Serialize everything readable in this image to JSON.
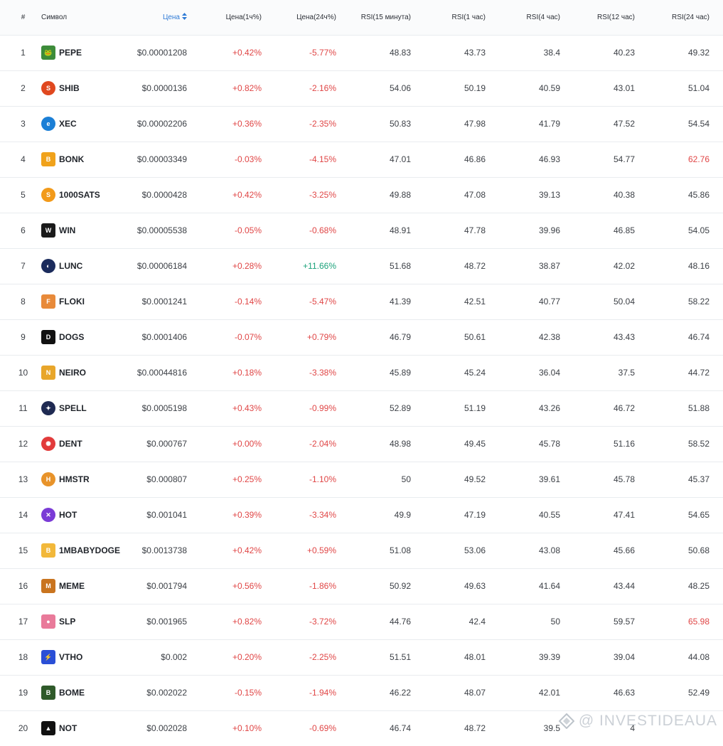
{
  "header": {
    "num": "#",
    "symbol": "Символ",
    "price": "Цена",
    "chg1h": "Цена(1ч%)",
    "chg24h": "Цена(24ч%)",
    "rsi15m": "RSI(15 минута)",
    "rsi1h": "RSI(1 час)",
    "rsi4h": "RSI(4 час)",
    "rsi12h": "RSI(12 час)",
    "rsi24h": "RSI(24 час)"
  },
  "colors": {
    "up": "#e04646",
    "down": "#1ba27a",
    "accent": "#2f7bd6",
    "neutral": "#3b3f45"
  },
  "rows": [
    {
      "n": "1",
      "sym": "PEPE",
      "icon": "pepe-frog-icon",
      "ic": "#3d8c3a",
      "price": "$0.00001208",
      "c1": "+0.42%",
      "c1c": "red",
      "c24": "-5.77%",
      "c24c": "red",
      "r15": "48.83",
      "r1": "43.73",
      "r4": "38.4",
      "r12": "40.23",
      "r24": "49.32",
      "r24c": "dark"
    },
    {
      "n": "2",
      "sym": "SHIB",
      "icon": "shiba-icon",
      "ic": "#e0481f",
      "price": "$0.0000136",
      "c1": "+0.82%",
      "c1c": "red",
      "c24": "-2.16%",
      "c24c": "red",
      "r15": "54.06",
      "r1": "50.19",
      "r4": "40.59",
      "r12": "43.01",
      "r24": "51.04",
      "r24c": "dark"
    },
    {
      "n": "3",
      "sym": "XEC",
      "icon": "ecash-icon",
      "ic": "#1b7fd6",
      "price": "$0.00002206",
      "c1": "+0.36%",
      "c1c": "red",
      "c24": "-2.35%",
      "c24c": "red",
      "r15": "50.83",
      "r1": "47.98",
      "r4": "41.79",
      "r12": "47.52",
      "r24": "54.54",
      "r24c": "dark"
    },
    {
      "n": "4",
      "sym": "BONK",
      "icon": "bonk-dog-icon",
      "ic": "#f0a21b",
      "price": "$0.00003349",
      "c1": "-0.03%",
      "c1c": "red",
      "c24": "-4.15%",
      "c24c": "red",
      "r15": "47.01",
      "r1": "46.86",
      "r4": "46.93",
      "r12": "54.77",
      "r24": "62.76",
      "r24c": "red"
    },
    {
      "n": "5",
      "sym": "1000SATS",
      "icon": "sats-coin-icon",
      "ic": "#f29a1a",
      "price": "$0.0000428",
      "c1": "+0.42%",
      "c1c": "red",
      "c24": "-3.25%",
      "c24c": "red",
      "r15": "49.88",
      "r1": "47.08",
      "r4": "39.13",
      "r12": "40.38",
      "r24": "45.86",
      "r24c": "dark"
    },
    {
      "n": "6",
      "sym": "WIN",
      "icon": "wink-icon",
      "ic": "#1a1a1a",
      "price": "$0.00005538",
      "c1": "-0.05%",
      "c1c": "red",
      "c24": "-0.68%",
      "c24c": "red",
      "r15": "48.91",
      "r1": "47.78",
      "r4": "39.96",
      "r12": "46.85",
      "r24": "54.05",
      "r24c": "dark"
    },
    {
      "n": "7",
      "sym": "LUNC",
      "icon": "luna-classic-icon",
      "ic": "#1b2b5c",
      "price": "$0.00006184",
      "c1": "+0.28%",
      "c1c": "red",
      "c24": "+11.66%",
      "c24c": "green",
      "r15": "51.68",
      "r1": "48.72",
      "r4": "38.87",
      "r12": "42.02",
      "r24": "48.16",
      "r24c": "dark"
    },
    {
      "n": "8",
      "sym": "FLOKI",
      "icon": "floki-viking-icon",
      "ic": "#e88a3a",
      "price": "$0.0001241",
      "c1": "-0.14%",
      "c1c": "red",
      "c24": "-5.47%",
      "c24c": "red",
      "r15": "41.39",
      "r1": "42.51",
      "r4": "40.77",
      "r12": "50.04",
      "r24": "58.22",
      "r24c": "dark"
    },
    {
      "n": "9",
      "sym": "DOGS",
      "icon": "dogs-icon",
      "ic": "#111111",
      "price": "$0.0001406",
      "c1": "-0.07%",
      "c1c": "red",
      "c24": "+0.79%",
      "c24c": "red",
      "r15": "46.79",
      "r1": "50.61",
      "r4": "42.38",
      "r12": "43.43",
      "r24": "46.74",
      "r24c": "dark"
    },
    {
      "n": "10",
      "sym": "NEIRO",
      "icon": "neiro-dog-icon",
      "ic": "#e8a62a",
      "price": "$0.00044816",
      "c1": "+0.18%",
      "c1c": "red",
      "c24": "-3.38%",
      "c24c": "red",
      "r15": "45.89",
      "r1": "45.24",
      "r4": "36.04",
      "r12": "37.5",
      "r24": "44.72",
      "r24c": "dark"
    },
    {
      "n": "11",
      "sym": "SPELL",
      "icon": "spell-wizard-icon",
      "ic": "#1f2a52",
      "price": "$0.0005198",
      "c1": "+0.43%",
      "c1c": "red",
      "c24": "-0.99%",
      "c24c": "red",
      "r15": "52.89",
      "r1": "51.19",
      "r4": "43.26",
      "r12": "46.72",
      "r24": "51.88",
      "r24c": "dark"
    },
    {
      "n": "12",
      "sym": "DENT",
      "icon": "dent-icon",
      "ic": "#e23b3b",
      "price": "$0.000767",
      "c1": "+0.00%",
      "c1c": "red",
      "c24": "-2.04%",
      "c24c": "red",
      "r15": "48.98",
      "r1": "49.45",
      "r4": "45.78",
      "r12": "51.16",
      "r24": "58.52",
      "r24c": "dark"
    },
    {
      "n": "13",
      "sym": "HMSTR",
      "icon": "hamster-icon",
      "ic": "#e8932a",
      "price": "$0.000807",
      "c1": "+0.25%",
      "c1c": "red",
      "c24": "-1.10%",
      "c24c": "red",
      "r15": "50",
      "r1": "49.52",
      "r4": "39.61",
      "r12": "45.78",
      "r24": "45.37",
      "r24c": "dark"
    },
    {
      "n": "14",
      "sym": "HOT",
      "icon": "holo-icon",
      "ic": "#7a3bd6",
      "price": "$0.001041",
      "c1": "+0.39%",
      "c1c": "red",
      "c24": "-3.34%",
      "c24c": "red",
      "r15": "49.9",
      "r1": "47.19",
      "r4": "40.55",
      "r12": "47.41",
      "r24": "54.65",
      "r24c": "dark"
    },
    {
      "n": "15",
      "sym": "1MBABYDOGE",
      "icon": "baby-doge-icon",
      "ic": "#f2b83a",
      "price": "$0.0013738",
      "c1": "+0.42%",
      "c1c": "red",
      "c24": "+0.59%",
      "c24c": "red",
      "r15": "51.08",
      "r1": "53.06",
      "r4": "43.08",
      "r12": "45.66",
      "r24": "50.68",
      "r24c": "dark"
    },
    {
      "n": "16",
      "sym": "MEME",
      "icon": "meme-icon",
      "ic": "#c9741f",
      "price": "$0.001794",
      "c1": "+0.56%",
      "c1c": "red",
      "c24": "-1.86%",
      "c24c": "red",
      "r15": "50.92",
      "r1": "49.63",
      "r4": "41.64",
      "r12": "43.44",
      "r24": "48.25",
      "r24c": "dark"
    },
    {
      "n": "17",
      "sym": "SLP",
      "icon": "slp-potion-icon",
      "ic": "#e97a9a",
      "price": "$0.001965",
      "c1": "+0.82%",
      "c1c": "red",
      "c24": "-3.72%",
      "c24c": "red",
      "r15": "44.76",
      "r1": "42.4",
      "r4": "50",
      "r12": "59.57",
      "r24": "65.98",
      "r24c": "red"
    },
    {
      "n": "18",
      "sym": "VTHO",
      "icon": "lightning-bolt-icon",
      "ic": "#2a4fd6",
      "price": "$0.002",
      "c1": "+0.20%",
      "c1c": "red",
      "c24": "-2.25%",
      "c24c": "red",
      "r15": "51.51",
      "r1": "48.01",
      "r4": "39.39",
      "r12": "39.04",
      "r24": "44.08",
      "r24c": "dark"
    },
    {
      "n": "19",
      "sym": "BOME",
      "icon": "book-of-meme-icon",
      "ic": "#2f5a2a",
      "price": "$0.002022",
      "c1": "-0.15%",
      "c1c": "red",
      "c24": "-1.94%",
      "c24c": "red",
      "r15": "46.22",
      "r1": "48.07",
      "r4": "42.01",
      "r12": "46.63",
      "r24": "52.49",
      "r24c": "dark"
    },
    {
      "n": "20",
      "sym": "NOT",
      "icon": "notcoin-icon",
      "ic": "#111111",
      "price": "$0.002028",
      "c1": "+0.10%",
      "c1c": "red",
      "c24": "-0.69%",
      "c24c": "red",
      "r15": "46.74",
      "r1": "48.72",
      "r4": "39.5",
      "r12": "4",
      "r24": "",
      "r24c": "dark"
    }
  ],
  "watermark": {
    "text": "@ INVESTIDEAUA",
    "icon": "diamond-logo-icon"
  }
}
